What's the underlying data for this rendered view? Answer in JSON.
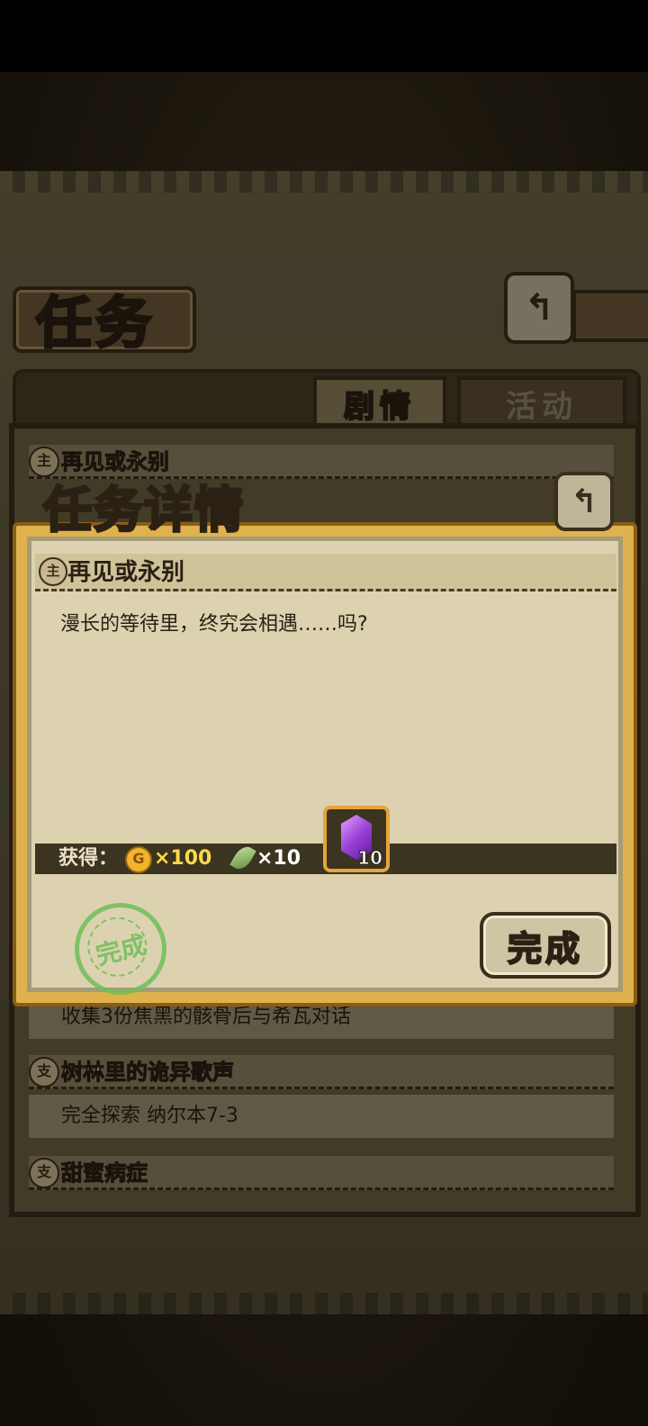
{
  "screen": {
    "title": "任务"
  },
  "tabs": [
    {
      "label": "剧情",
      "active": true
    },
    {
      "label": "活动",
      "active": false
    }
  ],
  "quests": [
    {
      "badge": "主",
      "title": "再见或永别",
      "description": ""
    },
    {
      "badge": "",
      "title": "",
      "description": "收集3份焦黑的骸骨后与希瓦对话"
    },
    {
      "badge": "支",
      "title": "树林里的诡异歌声",
      "description": "完全探索 纳尔本7-3"
    },
    {
      "badge": "支",
      "title": "甜蜜病症",
      "description": ""
    }
  ],
  "dialog": {
    "title": "任务详情",
    "quest_badge": "主",
    "quest_title": "再见或永别",
    "description": "漫长的等待里，终究会相遇……吗?",
    "reward_label": "获得：",
    "rewards": {
      "gold_icon": "G",
      "gold": "×100",
      "feather": "×10",
      "gem_count": "10"
    },
    "stamp_text": "完成",
    "complete_button": "完成"
  },
  "icons": {
    "back": "back-arrow-icon",
    "coin": "gold-coin-icon",
    "feather": "feather-icon",
    "gem": "purple-gem-icon"
  },
  "colors": {
    "accent": "#e0b24d",
    "stamp": "#6fbf5a",
    "gold_text": "#ffd84a"
  }
}
